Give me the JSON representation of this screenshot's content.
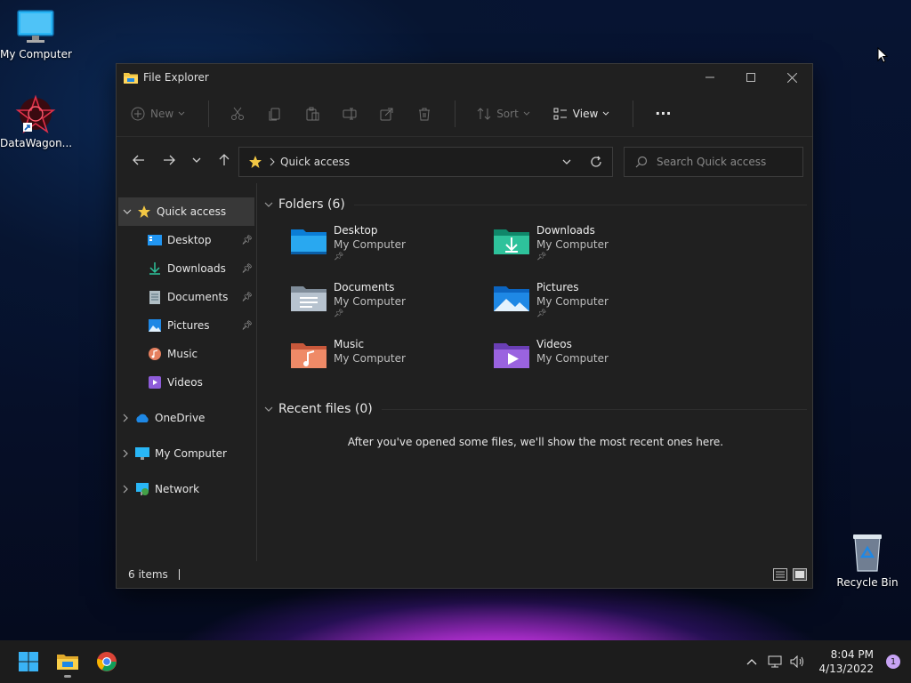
{
  "desktop": {
    "icons": [
      {
        "label": "My Computer"
      },
      {
        "label": "DataWagon..."
      },
      {
        "label": "Recycle Bin"
      }
    ]
  },
  "window": {
    "title": "File Explorer",
    "toolbar": {
      "new_label": "New",
      "sort_label": "Sort",
      "view_label": "View",
      "more_label": "···"
    },
    "address": {
      "crumb": "Quick access"
    },
    "search": {
      "placeholder": "Search Quick access"
    },
    "sidebar": {
      "items": [
        {
          "label": "Quick access"
        },
        {
          "label": "Desktop"
        },
        {
          "label": "Downloads"
        },
        {
          "label": "Documents"
        },
        {
          "label": "Pictures"
        },
        {
          "label": "Music"
        },
        {
          "label": "Videos"
        },
        {
          "label": "OneDrive"
        },
        {
          "label": "My Computer"
        },
        {
          "label": "Network"
        }
      ]
    },
    "folders_header": "Folders (6)",
    "folders": [
      {
        "name": "Desktop",
        "location": "My Computer"
      },
      {
        "name": "Downloads",
        "location": "My Computer"
      },
      {
        "name": "Documents",
        "location": "My Computer"
      },
      {
        "name": "Pictures",
        "location": "My Computer"
      },
      {
        "name": "Music",
        "location": "My Computer"
      },
      {
        "name": "Videos",
        "location": "My Computer"
      }
    ],
    "recent_header": "Recent files (0)",
    "recent_message": "After you've opened some files, we'll show the most recent ones here.",
    "status": {
      "items": "6 items"
    }
  },
  "taskbar": {
    "time": "8:04 PM",
    "date": "4/13/2022",
    "notification_count": "1"
  },
  "colors": {
    "accent": "#0078d4",
    "folder_yellow": "#f2c744",
    "window_bg": "#202020"
  }
}
